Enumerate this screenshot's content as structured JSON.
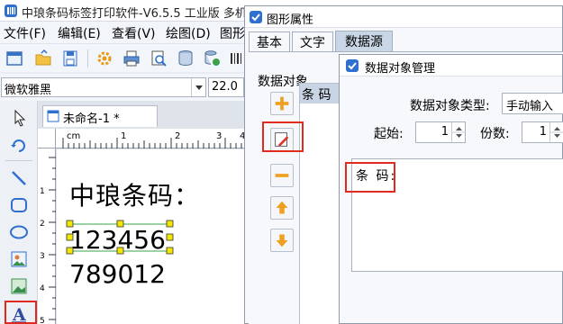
{
  "app": {
    "title": "中琅条码标签打印软件-V6.5.5 工业版 多机"
  },
  "menu": {
    "items": [
      "文件(F)",
      "编辑(E)",
      "查看(V)",
      "绘图(D)",
      "图形"
    ]
  },
  "font_bar": {
    "font_name": "微软雅黑",
    "font_size": "22.0"
  },
  "document": {
    "tab_label": "未命名-1 *",
    "ruler_unit": "cm",
    "ruler_ticks": [
      "1",
      "2",
      "3",
      "4"
    ],
    "ruler_left_ticks": [
      "1",
      "2",
      "3",
      "4",
      "5"
    ],
    "canvas": {
      "title_text": "中琅条码：",
      "line1": "123456",
      "line2": "789012"
    }
  },
  "properties_dialog": {
    "title": "图形属性",
    "tabs": [
      "基本",
      "文字",
      "数据源"
    ],
    "active_tab": "数据源",
    "data_object_group": "数据对象",
    "list_header": "条 码",
    "buttons": [
      "add-icon",
      "edit-icon",
      "remove-icon",
      "move-up-icon",
      "move-down-icon"
    ]
  },
  "data_object_dialog": {
    "title": "数据对象管理",
    "type_label": "数据对象类型:",
    "type_value": "手动输入",
    "start_label": "起始:",
    "start_value": "1",
    "copies_label": "份数:",
    "copies_value": "1",
    "text_value": "条 码:"
  },
  "colors": {
    "highlight_red": "#e02a1f",
    "selection_handle": "#f3e600",
    "accent_blue": "#2f6fd0"
  }
}
